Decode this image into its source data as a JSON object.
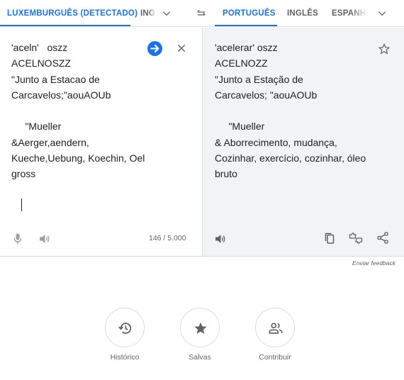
{
  "source_langs": {
    "detected": "LUXEMBURGUÊS (DETECTADO)",
    "second": "INGLÊS"
  },
  "target_langs": {
    "active": "PORTUGUÊS",
    "second": "INGLÊS",
    "third": "ESPANHOL"
  },
  "source_text": "'aceln'   oszz\nACELNOSZZ\n\"Junto a Estacao de\nCarcavelos;\"aouAOUb\n\n     \"Mueller\n&Aerger,aendern,\nKueche,Uebung, Koechin, Oel\ngross",
  "translation_text": "'acelerar' oszz\nACELNOZZ\n\"Junto a Estação de\nCarcavelos; \"aouAOUb\n\n     \"Mueller\n& Aborrecimento, mudança,\nCozinhar, exercício, cozinhar, óleo\nbruto",
  "char_counter": "146 / 5.000",
  "feedback_link": "Enviar feedback",
  "actions": {
    "history": "Histórico",
    "saved": "Salvas",
    "contribute": "Contribuir"
  },
  "colors": {
    "accent": "#1a73e8",
    "icon_gray": "#5f6368",
    "output_bg": "#f1f3f4"
  }
}
